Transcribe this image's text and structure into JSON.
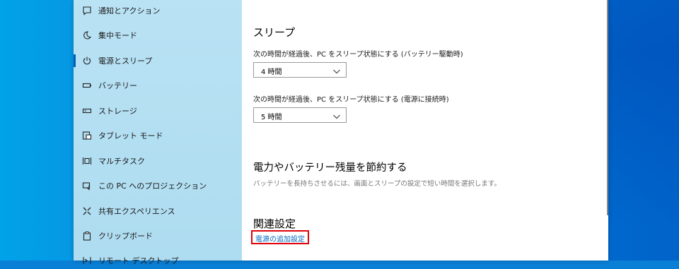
{
  "sidebar": {
    "items": [
      {
        "label": "通知とアクション",
        "icon": "notification-icon"
      },
      {
        "label": "集中モード",
        "icon": "moon-icon"
      },
      {
        "label": "電源とスリープ",
        "icon": "power-icon",
        "selected": true
      },
      {
        "label": "バッテリー",
        "icon": "battery-icon"
      },
      {
        "label": "ストレージ",
        "icon": "storage-icon"
      },
      {
        "label": "タブレット モード",
        "icon": "tablet-mode-icon"
      },
      {
        "label": "マルチタスク",
        "icon": "multitasking-icon"
      },
      {
        "label": "この PC へのプロジェクション",
        "icon": "projection-icon"
      },
      {
        "label": "共有エクスペリエンス",
        "icon": "shared-experiences-icon"
      },
      {
        "label": "クリップボード",
        "icon": "clipboard-icon"
      },
      {
        "label": "リモート デスクトップ",
        "icon": "remote-desktop-icon"
      }
    ]
  },
  "sleep": {
    "title": "スリープ",
    "battery_label": "次の時間が経過後、PC をスリープ状態にする (バッテリー駆動時)",
    "battery_value": "4 時間",
    "plugged_label": "次の時間が経過後、PC をスリープ状態にする (電源に接続時)",
    "plugged_value": "5 時間"
  },
  "save_power": {
    "title": "電力やバッテリー残量を節約する",
    "description": "バッテリーを長持ちさせるには、画面とスリープの設定で短い時間を選択します。"
  },
  "related": {
    "title": "関連設定",
    "link": "電源の追加設定"
  },
  "colors": {
    "accent": "#0063b1",
    "link": "#0067c0",
    "highlight_box": "#e3000b"
  }
}
